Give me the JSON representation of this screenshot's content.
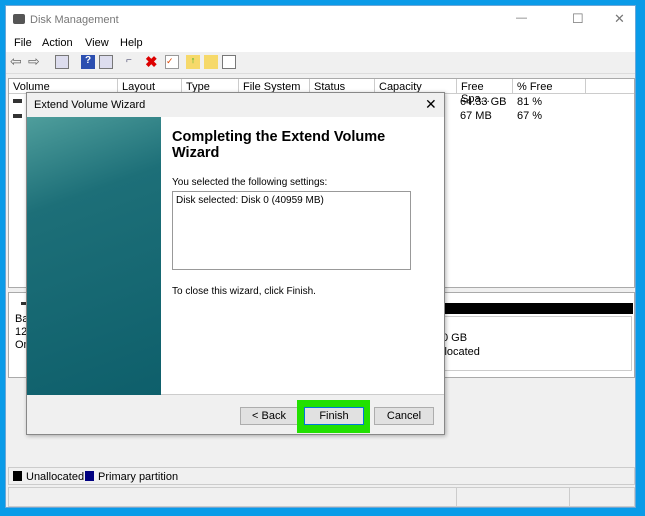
{
  "window": {
    "title": "Disk Management",
    "minimize": "—",
    "maximize": "☐",
    "close": "✕"
  },
  "menu": [
    "File",
    "Action",
    "View",
    "Help"
  ],
  "toolbar_icons": [
    "back-icon",
    "forward-icon",
    "console-tree-icon",
    "help-icon",
    "action-pane-icon",
    "connect-icon",
    "delete-icon",
    "properties-icon",
    "import-icon",
    "find-icon",
    "settings-icon"
  ],
  "columns": [
    "Volume",
    "Layout",
    "Type",
    "File System",
    "Status",
    "Capacity",
    "Free Spa...",
    "% Free"
  ],
  "rows": [
    {
      "free": "64.33 GB",
      "pct": "81 %"
    },
    {
      "free": "67 MB",
      "pct": "67 %"
    }
  ],
  "disk_partial": {
    "left": [
      "Ba",
      "12(",
      "On"
    ],
    "right": [
      "0 GB",
      "llocated"
    ]
  },
  "legend": [
    {
      "label": "Unallocated",
      "color": "#000000"
    },
    {
      "label": "Primary partition",
      "color": "#000080"
    }
  ],
  "dialog": {
    "title": "Extend Volume Wizard",
    "heading": "Completing the Extend Volume Wizard",
    "selected_label": "You selected the following settings:",
    "settings": "Disk selected: Disk 0 (40959 MB)",
    "close_text": "To close this wizard, click Finish.",
    "back": "< Back",
    "finish": "Finish",
    "cancel": "Cancel"
  },
  "highlight_color": "#22e000"
}
